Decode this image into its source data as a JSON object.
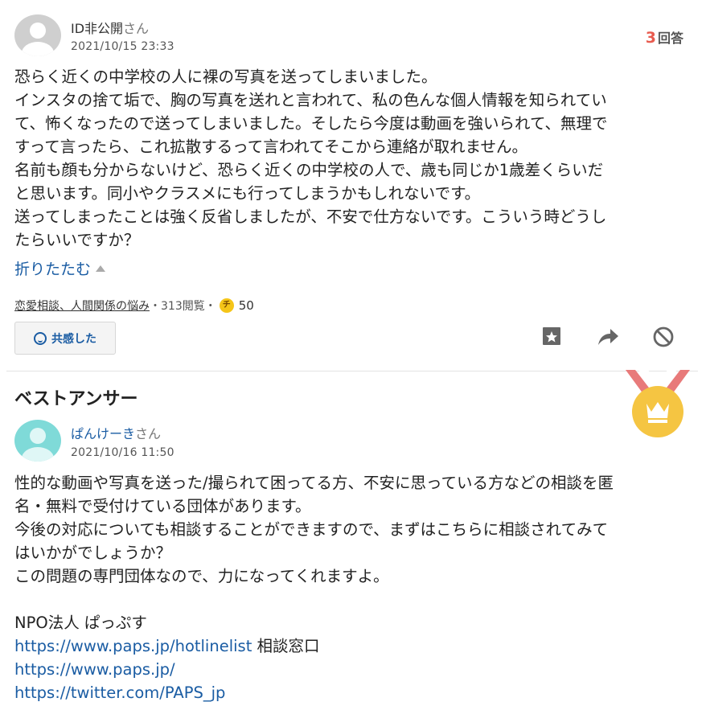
{
  "question": {
    "user_name": "ID非公開",
    "user_suffix": "さん",
    "date": "2021/10/15 23:33",
    "answer_count": "3",
    "answer_label": "回答",
    "lines": [
      "恐らく近くの中学校の人に裸の写真を送ってしまいました。",
      "インスタの捨て垢で、胸の写真を送れと言われて、私の色んな個人情報を知られてい",
      "て、怖くなったので送ってしまいました。そしたら今度は動画を強いられて、無理で",
      "すって言ったら、これ拡散するって言われてそこから連絡が取れません。",
      "名前も顔も分からないけど、恐らく近くの中学校の人で、歳も同じか1歳差くらいだ",
      "と思います。同小やクラスメにも行ってしまうかもしれないです。",
      "送ってしまったことは強く反省しましたが、不安で仕方ないです。こういう時どうし",
      "たらいいですか？"
    ],
    "collapse_label": "折りたたむ",
    "category": "恋愛相談、人間関係の悩み",
    "views": "・313閲覧・",
    "coin_icon_label": "チ",
    "coin_value": "50",
    "empathy_label": "共感した"
  },
  "best_answer": {
    "title": "ベストアンサー",
    "user_name": "ぱんけーき",
    "user_suffix": "さん",
    "date": "2021/10/16 11:50",
    "lines": [
      "性的な動画や写真を送った/撮られて困ってる方、不安に思っている方などの相談を匿",
      "名・無料で受付けている団体があります。",
      "今後の対応についても相談することができますので、まずはこちらに相談されてみて",
      "はいかがでしょうか？",
      "この問題の専門団体なので、力になってくれますよ。"
    ],
    "org": "NPO法人 ぱっぷす",
    "link1": "https://www.paps.jp/hotlinelist",
    "link1_suffix": " 相談窓口",
    "link2": "https://www.paps.jp/",
    "link3": "https://twitter.com/PAPS_jp"
  },
  "colors": {
    "accent": "#e85b4f",
    "link": "#1a5ca3",
    "avatar_question": "#cfcfcf",
    "avatar_answer": "#7fdad8",
    "medal_gold": "#f5c542",
    "medal_ribbon": "#e87a7a"
  },
  "icons": [
    "default-avatar-icon",
    "smile-icon",
    "bookmark-star-icon",
    "share-arrow-icon",
    "block-icon",
    "best-answer-medal-icon",
    "coin-icon"
  ]
}
